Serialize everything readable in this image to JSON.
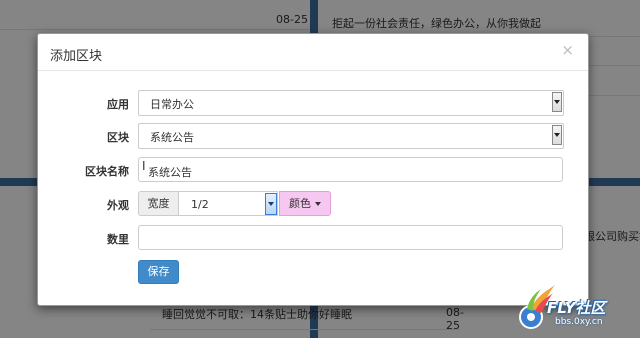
{
  "background": {
    "rows": [
      {
        "text": "",
        "date": "08-25"
      },
      {
        "text": "拒起一份社会责任，绿色办公，从你我做起",
        "date": ""
      },
      {
        "text": "",
        "date": ""
      },
      {
        "text": "",
        "date": ""
      },
      {
        "text": "睡回觉觉不可取：14条贴士助你好睡眠",
        "date": "08-25"
      }
    ],
    "right_partial_text": "限公司购买钢"
  },
  "modal": {
    "title": "添加区块",
    "close_icon": "×",
    "fields": {
      "app": {
        "label": "应用",
        "value": "日常办公"
      },
      "block": {
        "label": "区块",
        "value": "系统公告"
      },
      "block_name": {
        "label": "区块名称",
        "value": "系统公告"
      },
      "appearance": {
        "label": "外观",
        "width_addon": "宽度",
        "width_value": "1/2",
        "color_label": "颜色",
        "color_value": "#f6c7f0"
      },
      "quantity": {
        "label": "数里",
        "value": ""
      }
    },
    "save_label": "保存"
  },
  "watermark": {
    "brand": "FLY社区",
    "url": "bbs.0xy.cn"
  }
}
